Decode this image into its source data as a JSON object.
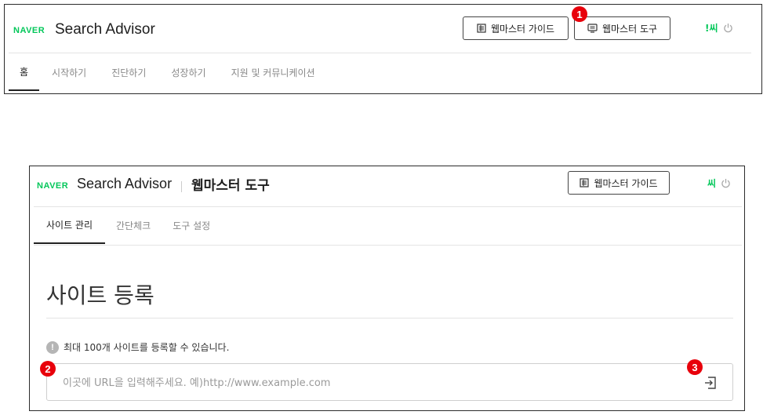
{
  "top": {
    "logo": "NAVER",
    "brand": "Search Advisor",
    "guide_button": "웹마스터 가이드",
    "tools_button": "웹마스터 도구",
    "user": "!씨",
    "tabs": [
      {
        "label": "홈"
      },
      {
        "label": "시작하기"
      },
      {
        "label": "진단하기"
      },
      {
        "label": "성장하기"
      },
      {
        "label": "지원 및 커뮤니케이션"
      }
    ]
  },
  "webmaster": {
    "logo": "NAVER",
    "brand": "Search Advisor",
    "section_title": "웹마스터 도구",
    "guide_button": "웹마스터 가이드",
    "user": "씨",
    "tabs": [
      {
        "label": "사이트 관리"
      },
      {
        "label": "간단체크"
      },
      {
        "label": "도구 설정"
      }
    ],
    "page_title": "사이트 등록",
    "info_icon": "!",
    "info_text": "최대 100개 사이트를 등록할 수 있습니다.",
    "url_input": {
      "value": "",
      "placeholder": "이곳에 URL을 입력해주세요. 예)http://www.example.com"
    }
  },
  "badges": [
    "1",
    "2",
    "3"
  ],
  "colors": {
    "naver_green": "#03c75a",
    "badge_red": "#e8000b"
  }
}
